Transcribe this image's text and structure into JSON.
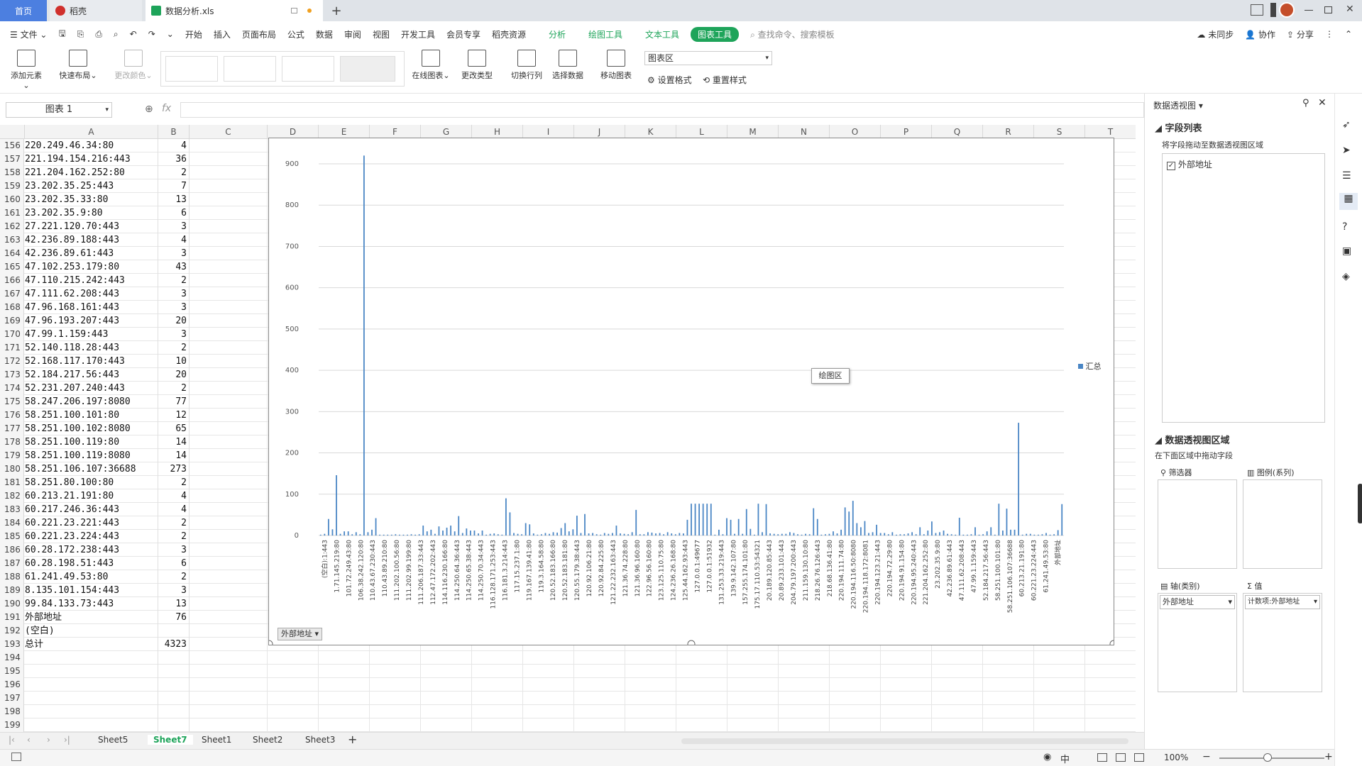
{
  "tabs": {
    "home": "首页",
    "daoke": "稻壳",
    "file": "数据分析.xls"
  },
  "menu": {
    "file": "文件",
    "items": [
      "开始",
      "插入",
      "页面布局",
      "公式",
      "数据",
      "审阅",
      "视图",
      "开发工具",
      "会员专享",
      "稻壳资源"
    ],
    "analysis": "分析",
    "draw": "绘图工具",
    "text": "文本工具",
    "chart_tools": "图表工具",
    "search": "查找命令、搜索模板",
    "unsync": "未同步",
    "collab": "协作",
    "share": "分享"
  },
  "ribbon": {
    "add_elem": "添加元素",
    "quick_layout": "快速布局",
    "change_color": "更改颜色",
    "online_chart": "在线图表",
    "change_type": "更改类型",
    "switch_rowcol": "切换行列",
    "select_data": "选择数据",
    "move_chart": "移动图表",
    "area_select": "图表区",
    "set_format": "设置格式",
    "reset_style": "重置样式"
  },
  "formula": {
    "name_box": "图表 1",
    "fx": "fx"
  },
  "columns": [
    "A",
    "B",
    "C",
    "D",
    "E",
    "F",
    "G",
    "H",
    "I",
    "J",
    "K",
    "L",
    "M",
    "N",
    "O",
    "P",
    "Q",
    "R",
    "S",
    "T"
  ],
  "rows": [
    {
      "n": "156",
      "a": "220.249.46.34:80",
      "b": "4"
    },
    {
      "n": "157",
      "a": "221.194.154.216:443",
      "b": "36"
    },
    {
      "n": "158",
      "a": "221.204.162.252:80",
      "b": "2"
    },
    {
      "n": "159",
      "a": "23.202.35.25:443",
      "b": "7"
    },
    {
      "n": "160",
      "a": "23.202.35.33:80",
      "b": "13"
    },
    {
      "n": "161",
      "a": "23.202.35.9:80",
      "b": "6"
    },
    {
      "n": "162",
      "a": "27.221.120.70:443",
      "b": "3"
    },
    {
      "n": "163",
      "a": "42.236.89.188:443",
      "b": "4"
    },
    {
      "n": "164",
      "a": "42.236.89.61:443",
      "b": "3"
    },
    {
      "n": "165",
      "a": "47.102.253.179:80",
      "b": "43"
    },
    {
      "n": "166",
      "a": "47.110.215.242:443",
      "b": "2"
    },
    {
      "n": "167",
      "a": "47.111.62.208:443",
      "b": "3"
    },
    {
      "n": "168",
      "a": "47.96.168.161:443",
      "b": "3"
    },
    {
      "n": "169",
      "a": "47.96.193.207:443",
      "b": "20"
    },
    {
      "n": "170",
      "a": "47.99.1.159:443",
      "b": "3"
    },
    {
      "n": "171",
      "a": "52.140.118.28:443",
      "b": "2"
    },
    {
      "n": "172",
      "a": "52.168.117.170:443",
      "b": "10"
    },
    {
      "n": "173",
      "a": "52.184.217.56:443",
      "b": "20"
    },
    {
      "n": "174",
      "a": "52.231.207.240:443",
      "b": "2"
    },
    {
      "n": "175",
      "a": "58.247.206.197:8080",
      "b": "77"
    },
    {
      "n": "176",
      "a": "58.251.100.101:80",
      "b": "12"
    },
    {
      "n": "177",
      "a": "58.251.100.102:8080",
      "b": "65"
    },
    {
      "n": "178",
      "a": "58.251.100.119:80",
      "b": "14"
    },
    {
      "n": "179",
      "a": "58.251.100.119:8080",
      "b": "14"
    },
    {
      "n": "180",
      "a": "58.251.106.107:36688",
      "b": "273"
    },
    {
      "n": "181",
      "a": "58.251.80.100:80",
      "b": "2"
    },
    {
      "n": "182",
      "a": "60.213.21.191:80",
      "b": "4"
    },
    {
      "n": "183",
      "a": "60.217.246.36:443",
      "b": "4"
    },
    {
      "n": "184",
      "a": "60.221.23.221:443",
      "b": "2"
    },
    {
      "n": "185",
      "a": "60.221.23.224:443",
      "b": "2"
    },
    {
      "n": "186",
      "a": "60.28.172.238:443",
      "b": "3"
    },
    {
      "n": "187",
      "a": "60.28.198.51:443",
      "b": "6"
    },
    {
      "n": "188",
      "a": "61.241.49.53:80",
      "b": "2"
    },
    {
      "n": "189",
      "a": "8.135.101.154:443",
      "b": "3"
    },
    {
      "n": "190",
      "a": "99.84.133.73:443",
      "b": "13"
    },
    {
      "n": "191",
      "a": "外部地址",
      "b": "76"
    },
    {
      "n": "192",
      "a": "(空白)",
      "b": ""
    },
    {
      "n": "193",
      "a": "总计",
      "b": "4323"
    },
    {
      "n": "194",
      "a": "",
      "b": ""
    },
    {
      "n": "195",
      "a": "",
      "b": ""
    },
    {
      "n": "196",
      "a": "",
      "b": ""
    },
    {
      "n": "197",
      "a": "",
      "b": ""
    },
    {
      "n": "198",
      "a": "",
      "b": ""
    },
    {
      "n": "199",
      "a": "",
      "b": ""
    }
  ],
  "chart_data": {
    "type": "bar",
    "ylim": [
      0,
      900
    ],
    "yticks": [
      0,
      100,
      200,
      300,
      400,
      500,
      600,
      700,
      800,
      900
    ],
    "legend": "汇总",
    "legend_pos": "right",
    "plot_area_label": "绘图区",
    "axis_field_button": "外部地址",
    "series": [
      {
        "name": "汇总",
        "values": [
          2,
          4,
          40,
          15,
          146,
          4,
          10,
          10,
          3,
          8,
          3,
          920,
          8,
          14,
          42,
          2,
          2,
          2,
          2,
          3,
          2,
          2,
          2,
          3,
          2,
          3,
          24,
          10,
          14,
          4,
          22,
          12,
          19,
          24,
          10,
          47,
          6,
          17,
          12,
          12,
          5,
          12,
          2,
          4,
          5,
          3,
          2,
          90,
          56,
          6,
          4,
          3,
          30,
          27,
          5,
          2,
          3,
          6,
          4,
          8,
          7,
          18,
          30,
          10,
          15,
          48,
          6,
          52,
          5,
          6,
          3,
          2,
          6,
          4,
          6,
          24,
          5,
          4,
          3,
          8,
          62,
          3,
          3,
          8,
          7,
          5,
          6,
          3,
          8,
          5,
          3,
          6,
          5,
          38,
          77,
          77,
          77,
          77,
          77,
          77,
          2,
          14,
          3,
          42,
          38,
          4,
          40,
          4,
          64,
          16,
          2,
          77,
          8,
          76,
          5,
          4,
          3,
          4,
          4,
          8,
          6,
          3,
          2,
          4,
          3,
          66,
          40,
          2,
          3,
          4,
          10,
          5,
          14,
          68,
          58,
          84,
          30,
          20,
          35,
          6,
          8,
          26,
          6,
          6,
          3,
          8,
          2,
          3,
          3,
          5,
          8,
          3,
          20,
          3,
          12,
          34,
          6,
          8,
          12,
          4,
          3,
          2,
          43,
          2,
          2,
          3,
          20,
          2,
          3,
          10,
          20,
          2,
          77,
          12,
          65,
          14,
          14,
          273,
          2,
          4,
          4,
          2,
          2,
          3,
          6,
          2,
          3,
          13,
          76
        ]
      }
    ],
    "tick_labels": [
      "(空白):1:443",
      "1.71.145.219:80",
      "101.72.249.43:80",
      "106.38.242.120:80",
      "110.43.67.230:443",
      "110.43.89.210:80",
      "111.202.100.56:80",
      "111.202.99.199:80",
      "111.206.187.33:443",
      "112.47.172.202:443",
      "114.116.230.166:80",
      "114.250.64.36:443",
      "114.250.65.38:443",
      "114.250.70.34:443",
      "116.128.171.253:443",
      "116.181.3.214:443",
      "117.15.237.1:80",
      "119.167.139.41:80",
      "119.3.164.58:80",
      "120.52.183.166:80",
      "120.52.183.181:80",
      "120.55.179.38:443",
      "120.92.106.21:80",
      "120.92.84.225:80",
      "121.22.232.163:443",
      "121.36.74.228:80",
      "121.36.96.160:80",
      "122.96.56.160:80",
      "123.125.110.75:80",
      "124.236.26.168:80",
      "125.44.162.93:443",
      "127.0.0.1:49677",
      "127.0.0.1:51932",
      "131.253.33.219:443",
      "139.9.142.107:80",
      "157.255.174.101:80",
      "175.17.110.53:54321",
      "20.189.120.85:443",
      "20.89.233.101:443",
      "204.79.197.200:443",
      "211.159.130.10:80",
      "218.26.76.126:443",
      "218.68.136.41:80",
      "220.194.111.74:80",
      "220.194.116.50:8080",
      "220.194.118.172:8081",
      "220.194.123.21:443",
      "220.194.72.29:80",
      "220.194.91.154:80",
      "220.194.95.240:443",
      "221.204.162.252:80",
      "23.202.35.9:80",
      "42.236.89.61:443",
      "47.111.62.208:443",
      "47.99.1.159:443",
      "52.184.217.56:443",
      "58.251.100.101:80",
      "58.251.106.107:36688",
      "60.213.21.191:80",
      "60.221.23.224:443",
      "61.241.49.53:80",
      "外部地址"
    ]
  },
  "sheets": [
    "Sheet5",
    "Sheet7",
    "Sheet1",
    "Sheet2",
    "Sheet3"
  ],
  "active_sheet": "Sheet7",
  "zoom": "100%",
  "pane": {
    "title": "数据透视图",
    "field_list": "字段列表",
    "drag_hint": "将字段拖动至数据透视图区域",
    "field_item": "外部地址",
    "area_title": "数据透视图区域",
    "area_hint": "在下面区域中拖动字段",
    "filter": "筛选器",
    "legend_series": "图例(系列)",
    "axis": "轴(类别)",
    "values": "值",
    "axis_value": "外部地址",
    "values_value": "计数项:外部地址"
  }
}
